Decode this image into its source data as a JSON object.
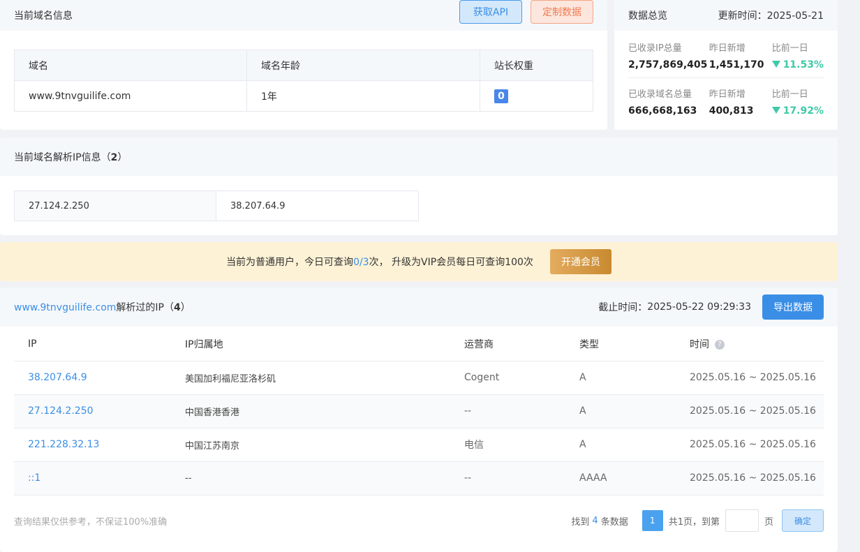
{
  "domain_info": {
    "title": "当前域名信息",
    "api_button": "获取API",
    "custom_button": "定制数据",
    "headers": [
      "域名",
      "域名年龄",
      "站长权重"
    ],
    "domain": "www.9tnvguilife.com",
    "age": "1年",
    "weight": "0"
  },
  "stats": {
    "title": "数据总览",
    "update_label": "更新时间：",
    "update_date": "2025-05-21",
    "rows": [
      {
        "total_label": "已收录IP总量",
        "total": "2,757,869,405",
        "new_label": "昨日新增",
        "new": "1,451,170",
        "cmp_label": "比前一日",
        "cmp": "11.53%"
      },
      {
        "total_label": "已收录域名总量",
        "total": "666,668,163",
        "new_label": "昨日新增",
        "new": "400,813",
        "cmp_label": "比前一日",
        "cmp": "17.92%"
      }
    ]
  },
  "ip_info": {
    "title_prefix": "当前域名解析IP信息（",
    "count": "2",
    "title_suffix": "）",
    "ips": [
      "27.124.2.250",
      "38.207.64.9"
    ]
  },
  "banner": {
    "text_a": "当前为普通用户，今日可查询",
    "quota": "0/3",
    "text_b": "次，  升级为VIP会员每日可查询100次",
    "vip_button": "开通会员"
  },
  "history": {
    "domain_link": "www.9tnvguilife.com",
    "title_mid": "解析过的IP（",
    "count": "4",
    "title_suffix": "）",
    "cutoff_label": "截止时间：",
    "cutoff_time": "2025-05-22 09:29:33",
    "export_button": "导出数据",
    "headers": [
      "IP",
      "IP归属地",
      "运营商",
      "类型",
      "时间"
    ],
    "rows": [
      {
        "ip": "38.207.64.9",
        "loc": "美国加利福尼亚洛杉矶",
        "isp": "Cogent",
        "type": "A",
        "time": "2025.05.16 ~ 2025.05.16"
      },
      {
        "ip": "27.124.2.250",
        "loc": "中国香港香港",
        "isp": "--",
        "type": "A",
        "time": "2025.05.16 ~ 2025.05.16"
      },
      {
        "ip": "221.228.32.13",
        "loc": "中国江苏南京",
        "isp": "电信",
        "type": "A",
        "time": "2025.05.16 ~ 2025.05.16"
      },
      {
        "ip": "::1",
        "loc": "--",
        "isp": "--",
        "type": "AAAA",
        "time": "2025.05.16 ~ 2025.05.16"
      }
    ],
    "disclaimer": "查询结果仅供参考，不保证100%准确",
    "pager": {
      "found_a": "找到",
      "found_count": "4",
      "found_b": "条数据",
      "page": "1",
      "total_pages": "共1页，到第",
      "page_unit": "页",
      "ok_button": "确定"
    }
  }
}
